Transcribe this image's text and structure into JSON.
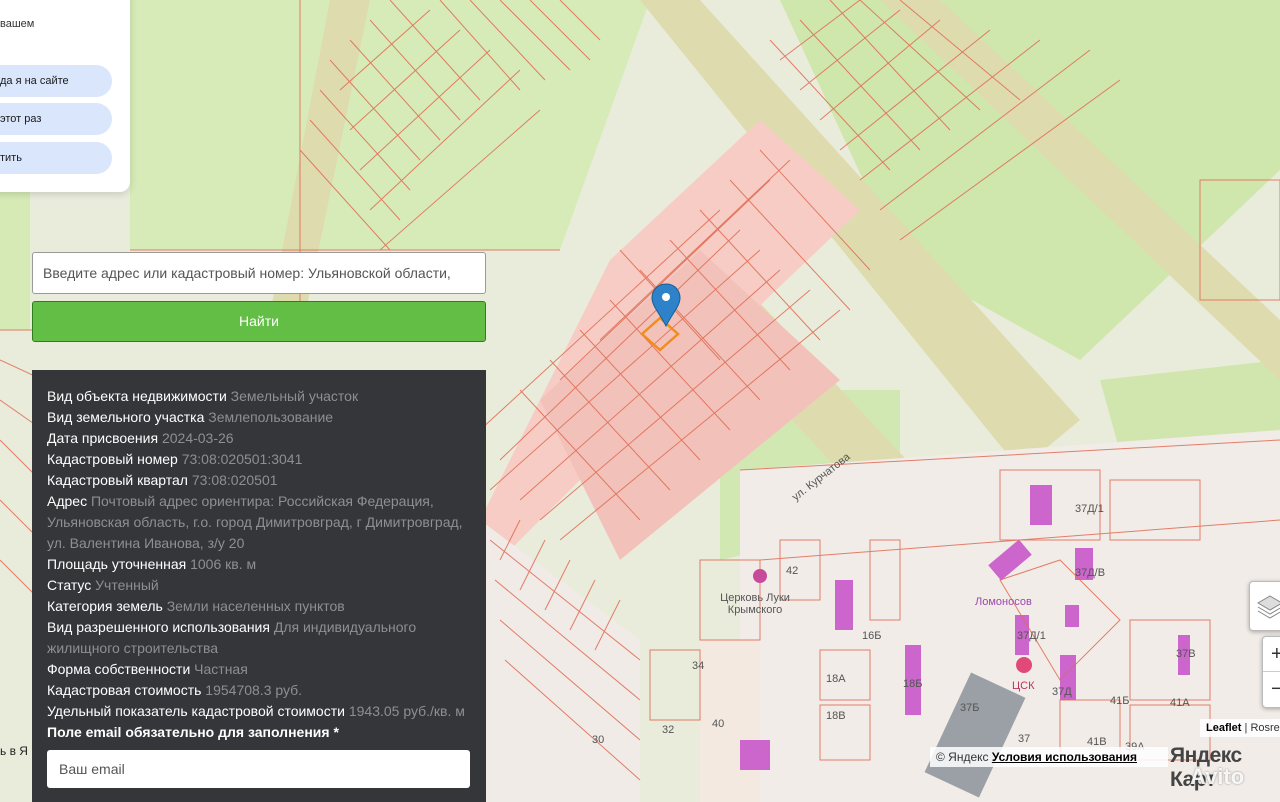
{
  "chat": {
    "snippet": "вашем",
    "options": [
      "да я на сайте",
      "этот раз",
      "тить"
    ]
  },
  "search": {
    "placeholder": "Введите адрес или кадастровый номер: Ульяновской области,",
    "button": "Найти"
  },
  "info": {
    "rows": [
      {
        "k": "Вид объекта недвижимости",
        "v": "Земельный участок"
      },
      {
        "k": "Вид земельного участка",
        "v": "Землепользование"
      },
      {
        "k": "Дата присвоения",
        "v": "2024-03-26"
      },
      {
        "k": "Кадастровый номер",
        "v": "73:08:020501:3041"
      },
      {
        "k": "Кадастровый квартал",
        "v": "73:08:020501"
      },
      {
        "k": "Адрес",
        "v": "Почтовый адрес ориентира: Российская Федерация, Ульяновская область, г.о. город Димитровград, г Димитровград, ул. Валентина Иванова, з/у 20"
      },
      {
        "k": "Площадь уточненная",
        "v": "1006 кв. м"
      },
      {
        "k": "Статус",
        "v": "Учтенный"
      },
      {
        "k": "Категория земель",
        "v": "Земли населенных пунктов"
      },
      {
        "k": "Вид разрешенного использования",
        "v": "Для индивидуального жилищного строительства"
      },
      {
        "k": "Форма собственности",
        "v": "Частная"
      },
      {
        "k": "Кадастровая стоимость",
        "v": "1954708.3 руб."
      },
      {
        "k": "Удельный показатель кадастровой стоимости",
        "v": "1943.05 руб./кв. м"
      }
    ],
    "email_label": "Поле email обязательно для заполнения *",
    "email_placeholder": "Ваш email"
  },
  "map": {
    "street": "ул. Курчатова",
    "church": "Церковь Луки Крымского",
    "lomonosov": "Ломоносов",
    "csk": "ЦСК",
    "house_numbers": [
      "42",
      "16Б",
      "18Б",
      "18А",
      "18В",
      "34",
      "32",
      "40",
      "30",
      "37Д/1",
      "37Д/В",
      "37Д/1",
      "37Д",
      "37В",
      "41Б",
      "41А",
      "41В",
      "39А",
      "37",
      "37Б"
    ],
    "left_cut": "ь в Я"
  },
  "controls": {
    "zoom_in": "+",
    "zoom_out": "−"
  },
  "attribution": {
    "leaflet": "Leaflet",
    "rest": "| Rosre"
  },
  "yandex": {
    "copy": "© Яндекс",
    "terms": "Условия использования",
    "logo": "Яндекс Карт"
  },
  "watermark": "Avito"
}
